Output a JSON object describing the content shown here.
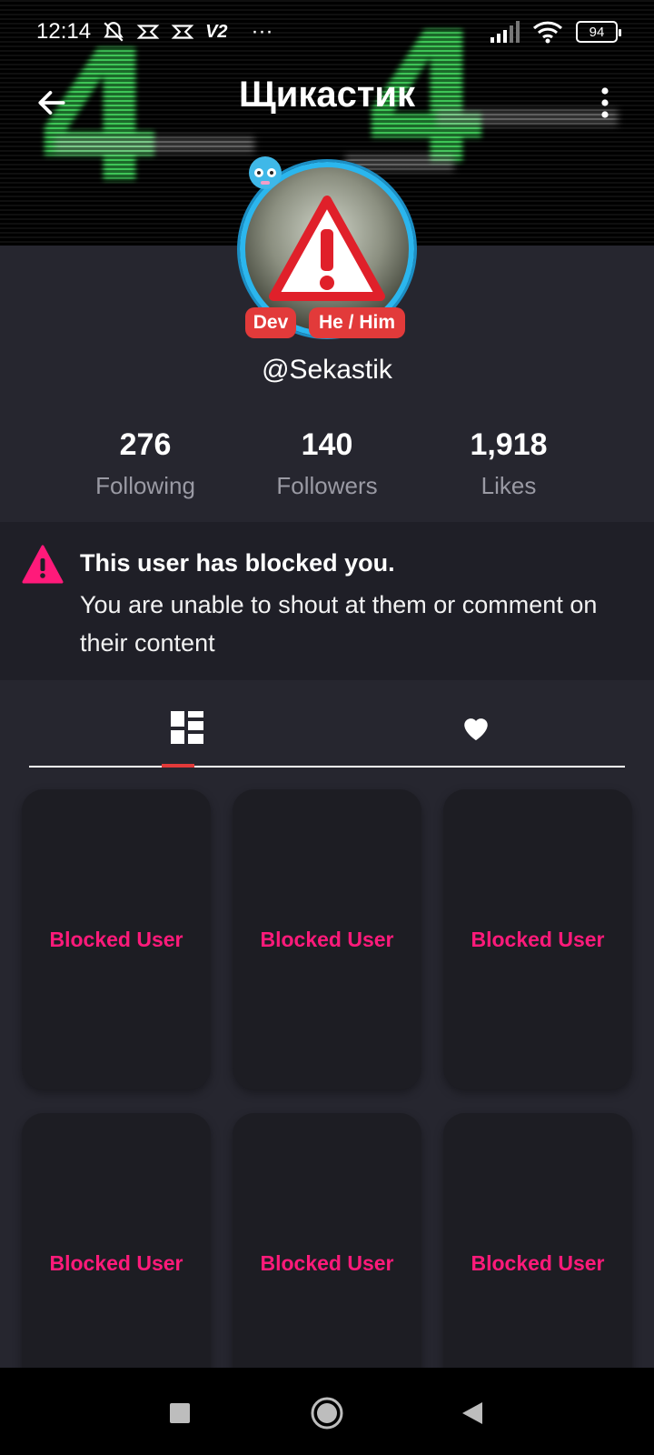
{
  "status_bar": {
    "time": "12:14",
    "vpn_label": "V2",
    "more_dots": "···",
    "battery": "94"
  },
  "header": {
    "title": "Щикастик"
  },
  "profile": {
    "username": "@Sekastik",
    "tags": [
      "Dev",
      "He / Him"
    ],
    "accent_ring_color": "#2bb6ee"
  },
  "stats": [
    {
      "value": "276",
      "label": "Following"
    },
    {
      "value": "140",
      "label": "Followers"
    },
    {
      "value": "1,918",
      "label": "Likes"
    }
  ],
  "notice": {
    "title": "This user has blocked you.",
    "body": "You are unable to shout at them or comment on their content",
    "icon": "warning-icon",
    "icon_color": "#ff1a7a"
  },
  "tabs": [
    {
      "name": "posts",
      "icon": "grid-icon",
      "active": true
    },
    {
      "name": "likes",
      "icon": "heart-icon",
      "active": false
    }
  ],
  "cards": [
    {
      "label": "Blocked User"
    },
    {
      "label": "Blocked User"
    },
    {
      "label": "Blocked User"
    },
    {
      "label": "Blocked User"
    },
    {
      "label": "Blocked User"
    },
    {
      "label": "Blocked User"
    }
  ],
  "colors": {
    "background": "#26262f",
    "blocked_text": "#ff1a7a",
    "tag_bg": "#e23a3a",
    "tab_indicator": "#e23a3a"
  }
}
